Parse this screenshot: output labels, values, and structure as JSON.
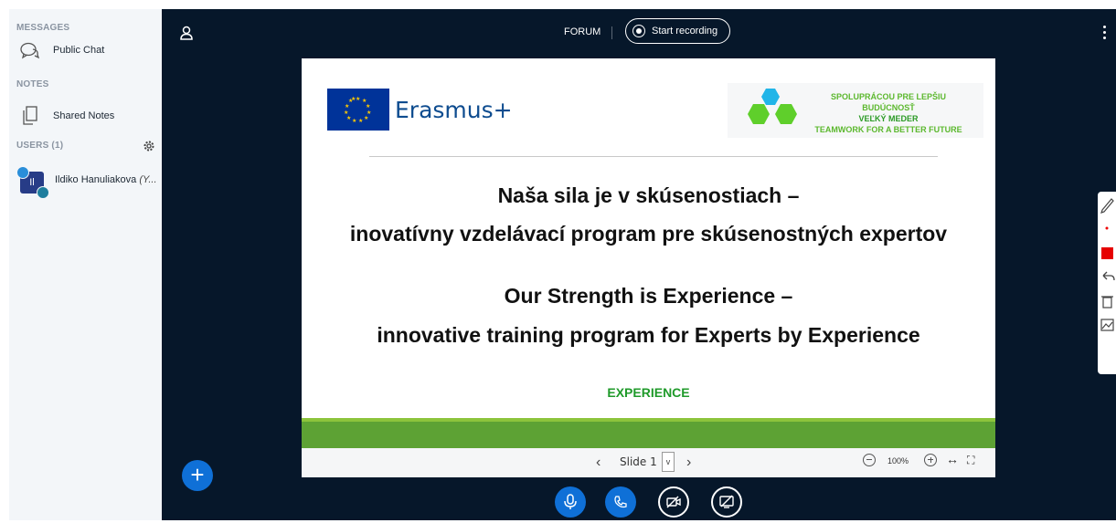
{
  "sidebar": {
    "messages_title": "MESSAGES",
    "public_chat": "Public Chat",
    "notes_title": "NOTES",
    "shared_notes": "Shared Notes",
    "users_title": "USERS (1)",
    "user": {
      "initials": "Il",
      "name": "Ildiko Hanuliakova",
      "suffix": "(Y..."
    }
  },
  "topbar": {
    "title": "FORUM",
    "record_label": "Start recording"
  },
  "slide": {
    "erasmus_label": "Erasmus+",
    "partner": {
      "line1": "SPOLUPRÁCOU PRE LEPŠIU BUDÚCNOSŤ",
      "line2": "VEĽKÝ  MEDER",
      "line3": "TEAMWORK FOR A BETTER FUTURE"
    },
    "title_sk_1": "Naša sila je v skúsenostiach –",
    "title_sk_2": "inovatívny vzdelávací program pre skúsenostných expertov",
    "title_en_1": "Our Strength is Experience –",
    "title_en_2": "innovative training program for Experts by Experience",
    "tag": "EXPERIENCE"
  },
  "slide_controls": {
    "slide_label": "Slide 1",
    "zoom": "100%"
  },
  "icons": {
    "chat": "chat-icon",
    "notes": "notes-icon",
    "gear": "gear-icon",
    "user": "user-icon",
    "more": "kebab-icon",
    "plus": "plus-icon",
    "mic": "microphone-icon",
    "phone": "phone-icon",
    "camera_off": "camera-off-icon",
    "screen_share_off": "screen-share-off-icon"
  },
  "colors": {
    "accent": "#0f70d7",
    "background": "#06172a",
    "sidebar": "#f3f6f9",
    "slide_green": "#5da234"
  }
}
